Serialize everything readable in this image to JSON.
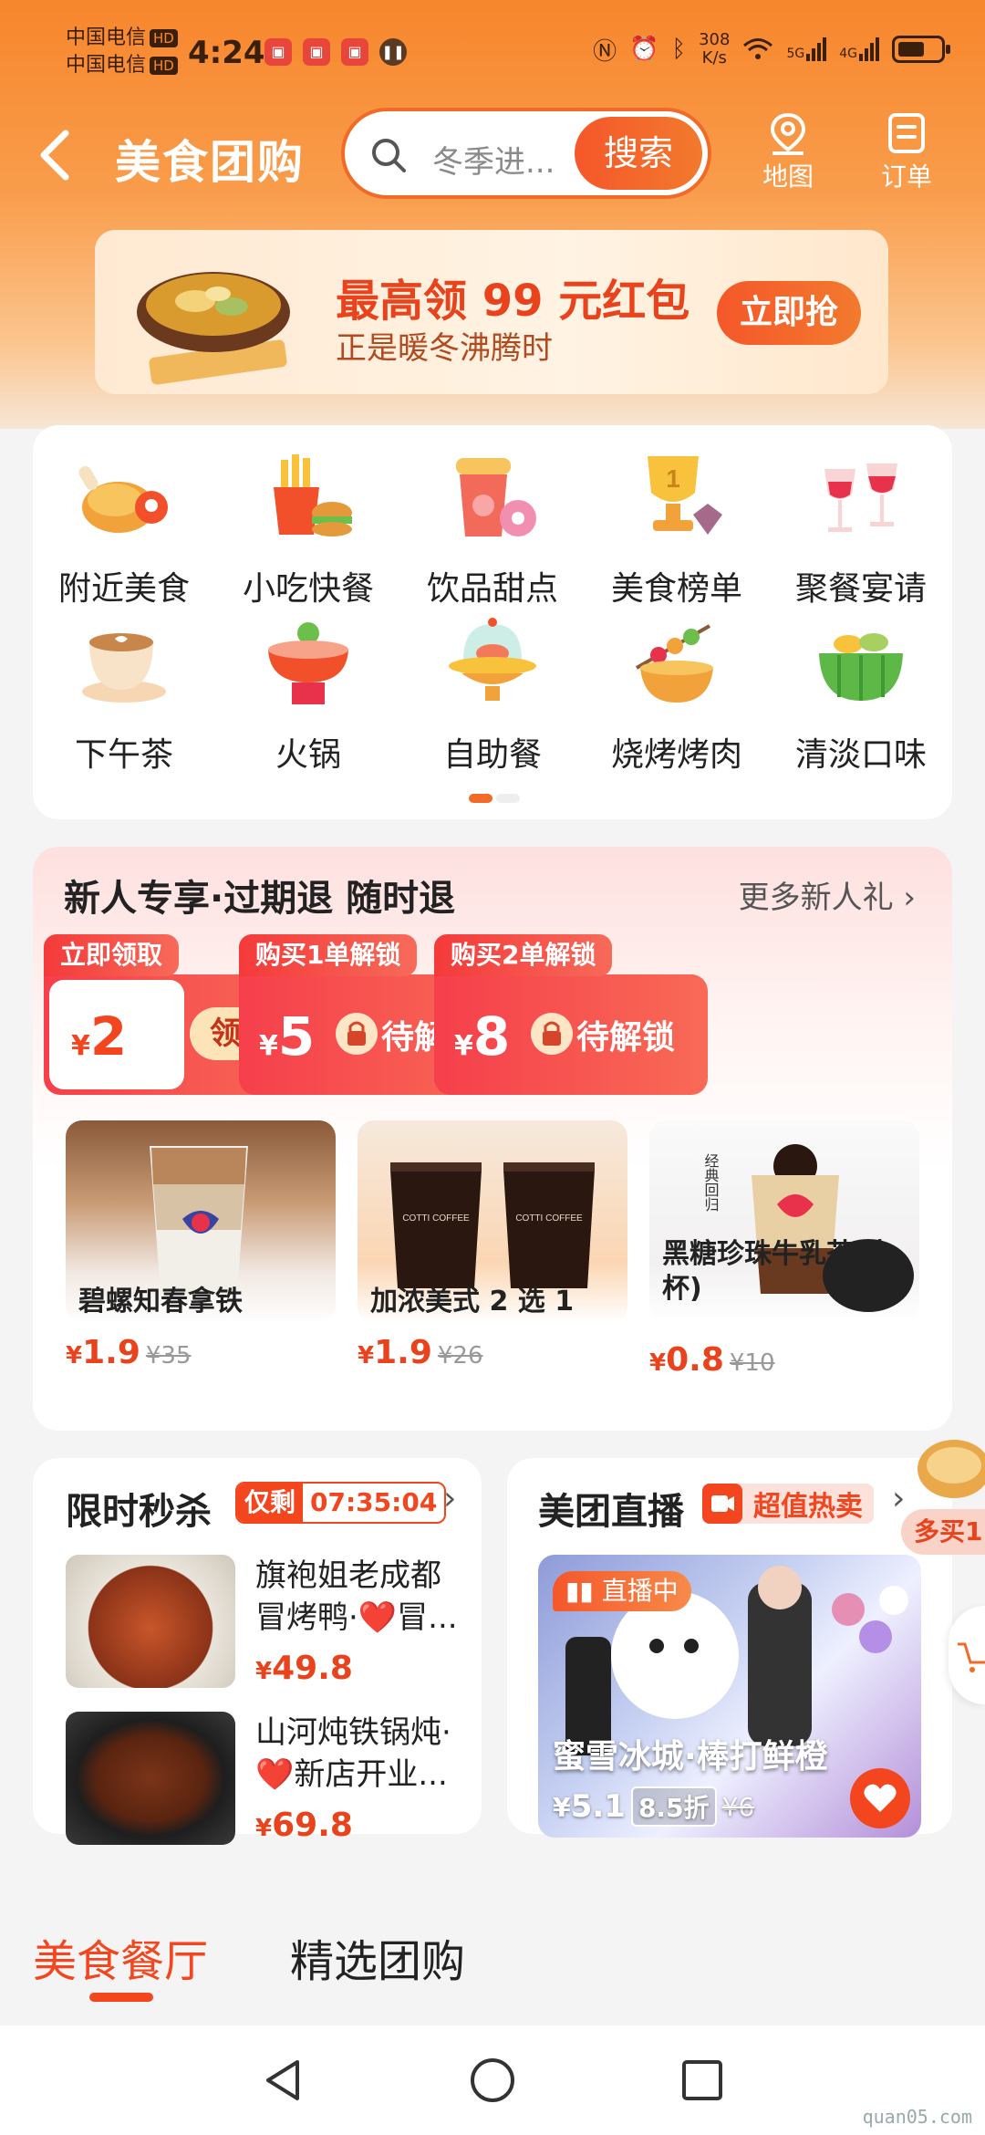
{
  "status_bar": {
    "carrier1": "中国电信",
    "carrier2": "中国电信",
    "hd": "HD",
    "time": "4:24",
    "net_speed_top": "308",
    "net_speed_bottom": "K/s",
    "net_5g": "5G",
    "net_4g": "4G"
  },
  "header": {
    "title": "美食团购",
    "search_placeholder": "冬季进...",
    "search_button": "搜索",
    "map_label": "地图",
    "orders_label": "订单"
  },
  "banner": {
    "title": "最高领 99 元红包",
    "subtitle": "正是暖冬沸腾时",
    "button": "立即抢"
  },
  "categories": [
    {
      "label": "附近美食",
      "icon": "roast-chicken-icon"
    },
    {
      "label": "小吃快餐",
      "icon": "fries-burger-icon"
    },
    {
      "label": "饮品甜点",
      "icon": "drink-donut-icon"
    },
    {
      "label": "美食榜单",
      "icon": "trophy-icon"
    },
    {
      "label": "聚餐宴请",
      "icon": "wine-glasses-icon"
    },
    {
      "label": "下午茶",
      "icon": "coffee-cup-icon"
    },
    {
      "label": "火锅",
      "icon": "hotpot-icon"
    },
    {
      "label": "自助餐",
      "icon": "buffet-dome-icon"
    },
    {
      "label": "烧烤烤肉",
      "icon": "skewer-icon"
    },
    {
      "label": "清淡口味",
      "icon": "salad-bowl-icon"
    }
  ],
  "newbie": {
    "title": "新人专享·过期退 随时退",
    "more": "更多新人礼",
    "coupons": [
      {
        "tag": "立即领取",
        "currency": "¥",
        "amount": "2",
        "action": "领取"
      },
      {
        "tag": "购买1单解锁",
        "currency": "¥",
        "amount": "5",
        "action": "待解锁"
      },
      {
        "tag": "购买2单解锁",
        "currency": "¥",
        "amount": "8",
        "action": "待解锁"
      }
    ],
    "products": [
      {
        "name": "碧螺知春拿铁",
        "currency": "¥",
        "price": "1.9",
        "original": "¥35"
      },
      {
        "name": "加浓美式 2 选 1",
        "currency": "¥",
        "price": "1.9",
        "original": "¥26"
      },
      {
        "name": "黑糖珍珠牛乳茶(中杯)",
        "currency": "¥",
        "price": "0.8",
        "original": "¥10"
      }
    ],
    "product_texts": {
      "coffee_brand": "COTTI COFFEE",
      "tea_vertical": "经典回归"
    }
  },
  "flash_sale": {
    "title": "限时秒杀",
    "remain_label": "仅剩",
    "countdown": "07:35:04",
    "items": [
      {
        "name": "旗袍姐老成都冒烤鸭·❤️冒...",
        "currency": "¥",
        "price": "49.8"
      },
      {
        "name": "山河炖铁锅炖·❤️新店开业...",
        "currency": "¥",
        "price": "69.8"
      }
    ]
  },
  "live": {
    "title": "美团直播",
    "badge": "超值热卖",
    "tag": "直播中",
    "name": "蜜雪冰城·棒打鲜橙",
    "currency": "¥",
    "price": "5.1",
    "discount": "8.5折",
    "original": "¥6"
  },
  "side_float": {
    "label": "多买1"
  },
  "tabs": [
    {
      "label": "美食餐厅",
      "active": true
    },
    {
      "label": "精选团购",
      "active": false
    }
  ],
  "watermark": "quan05.com",
  "colors": {
    "brand": "#f26a27",
    "accent_red": "#f3461e",
    "price": "#e8431d"
  }
}
